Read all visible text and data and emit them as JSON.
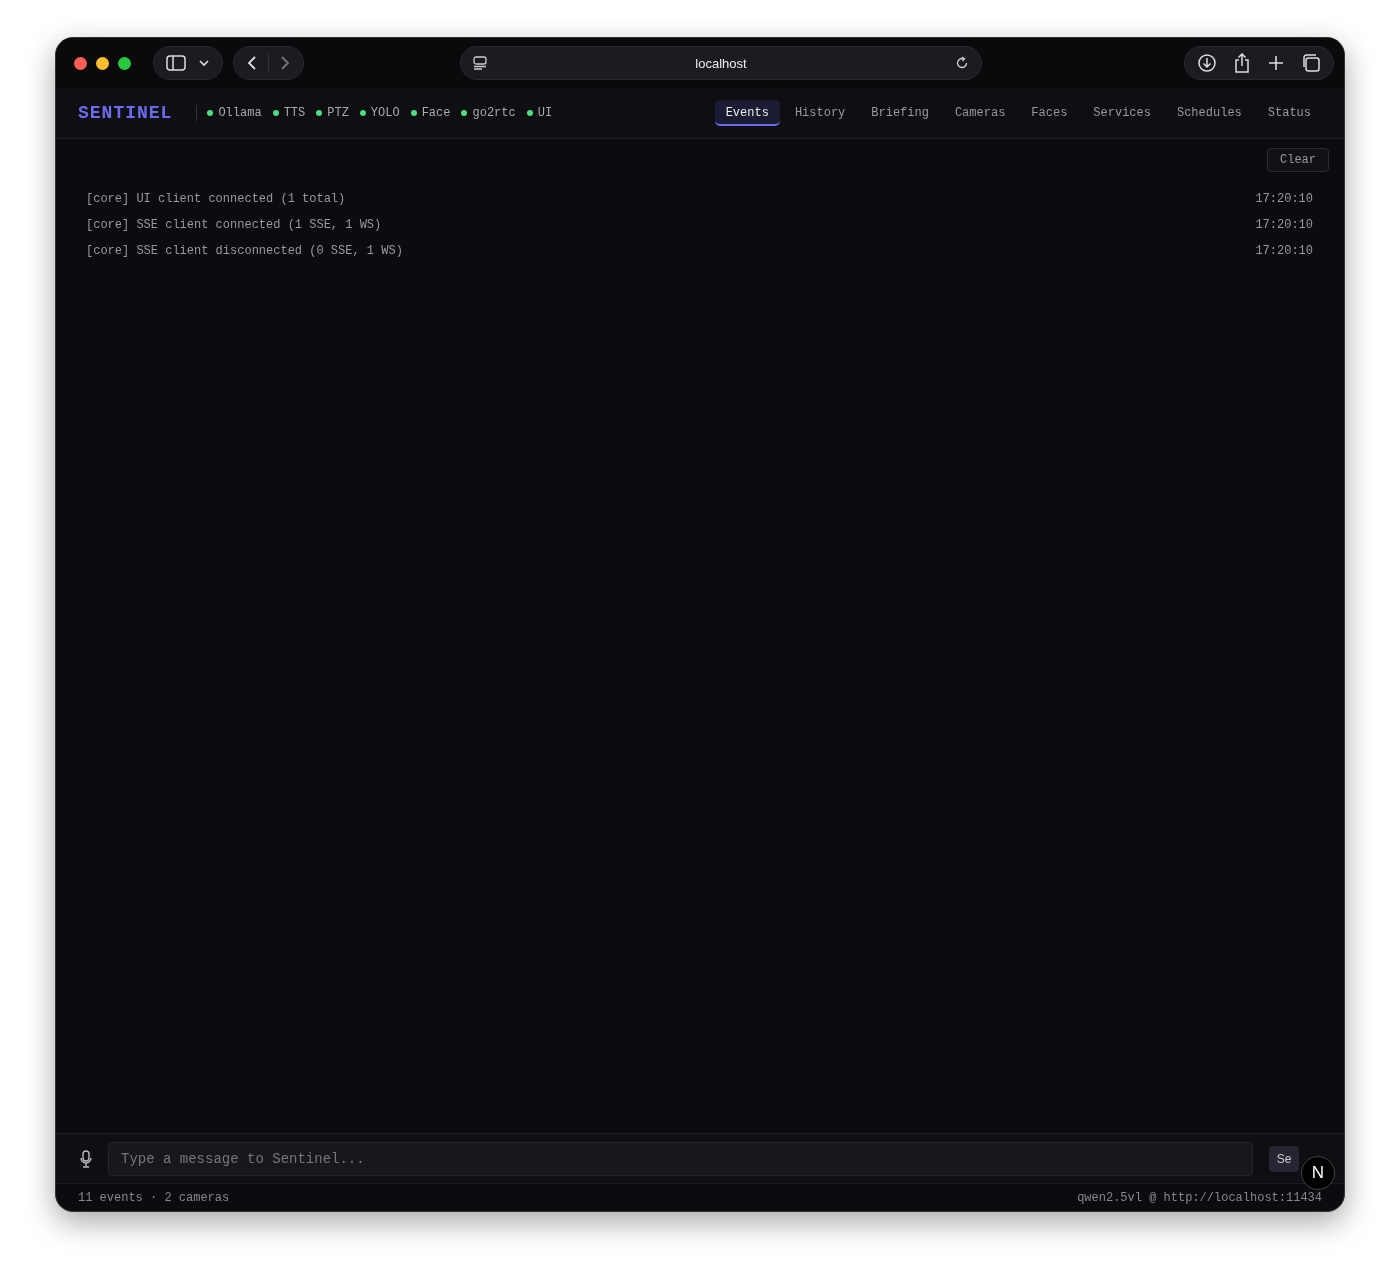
{
  "browser": {
    "address": "localhost"
  },
  "app": {
    "brand": "SENTINEL",
    "services": [
      {
        "name": "Ollama",
        "color": "#4ade80"
      },
      {
        "name": "TTS",
        "color": "#4ade80"
      },
      {
        "name": "PTZ",
        "color": "#4ade80"
      },
      {
        "name": "YOLO",
        "color": "#4ade80"
      },
      {
        "name": "Face",
        "color": "#4ade80"
      },
      {
        "name": "go2rtc",
        "color": "#4ade80"
      },
      {
        "name": "UI",
        "color": "#4ade80"
      }
    ],
    "tabs": [
      {
        "label": "Events",
        "selected": true
      },
      {
        "label": "History",
        "selected": false
      },
      {
        "label": "Briefing",
        "selected": false
      },
      {
        "label": "Cameras",
        "selected": false
      },
      {
        "label": "Faces",
        "selected": false
      },
      {
        "label": "Services",
        "selected": false
      },
      {
        "label": "Schedules",
        "selected": false
      },
      {
        "label": "Status",
        "selected": false
      }
    ]
  },
  "events": {
    "clear_button": "Clear",
    "rows": [
      {
        "message": "[core] UI client connected (1 total)",
        "time": "17:20:10"
      },
      {
        "message": "[core] SSE client connected (1 SSE, 1 WS)",
        "time": "17:20:10"
      },
      {
        "message": "[core] SSE client disconnected (0 SSE, 1 WS)",
        "time": "17:20:10"
      }
    ]
  },
  "chat": {
    "placeholder": "Type a message to Sentinel...",
    "send_button": "Se"
  },
  "dev_badge": "N",
  "status_bar": {
    "left": "11 events · 2 cameras",
    "right": "qwen2.5vl @ http://localhost:11434"
  }
}
